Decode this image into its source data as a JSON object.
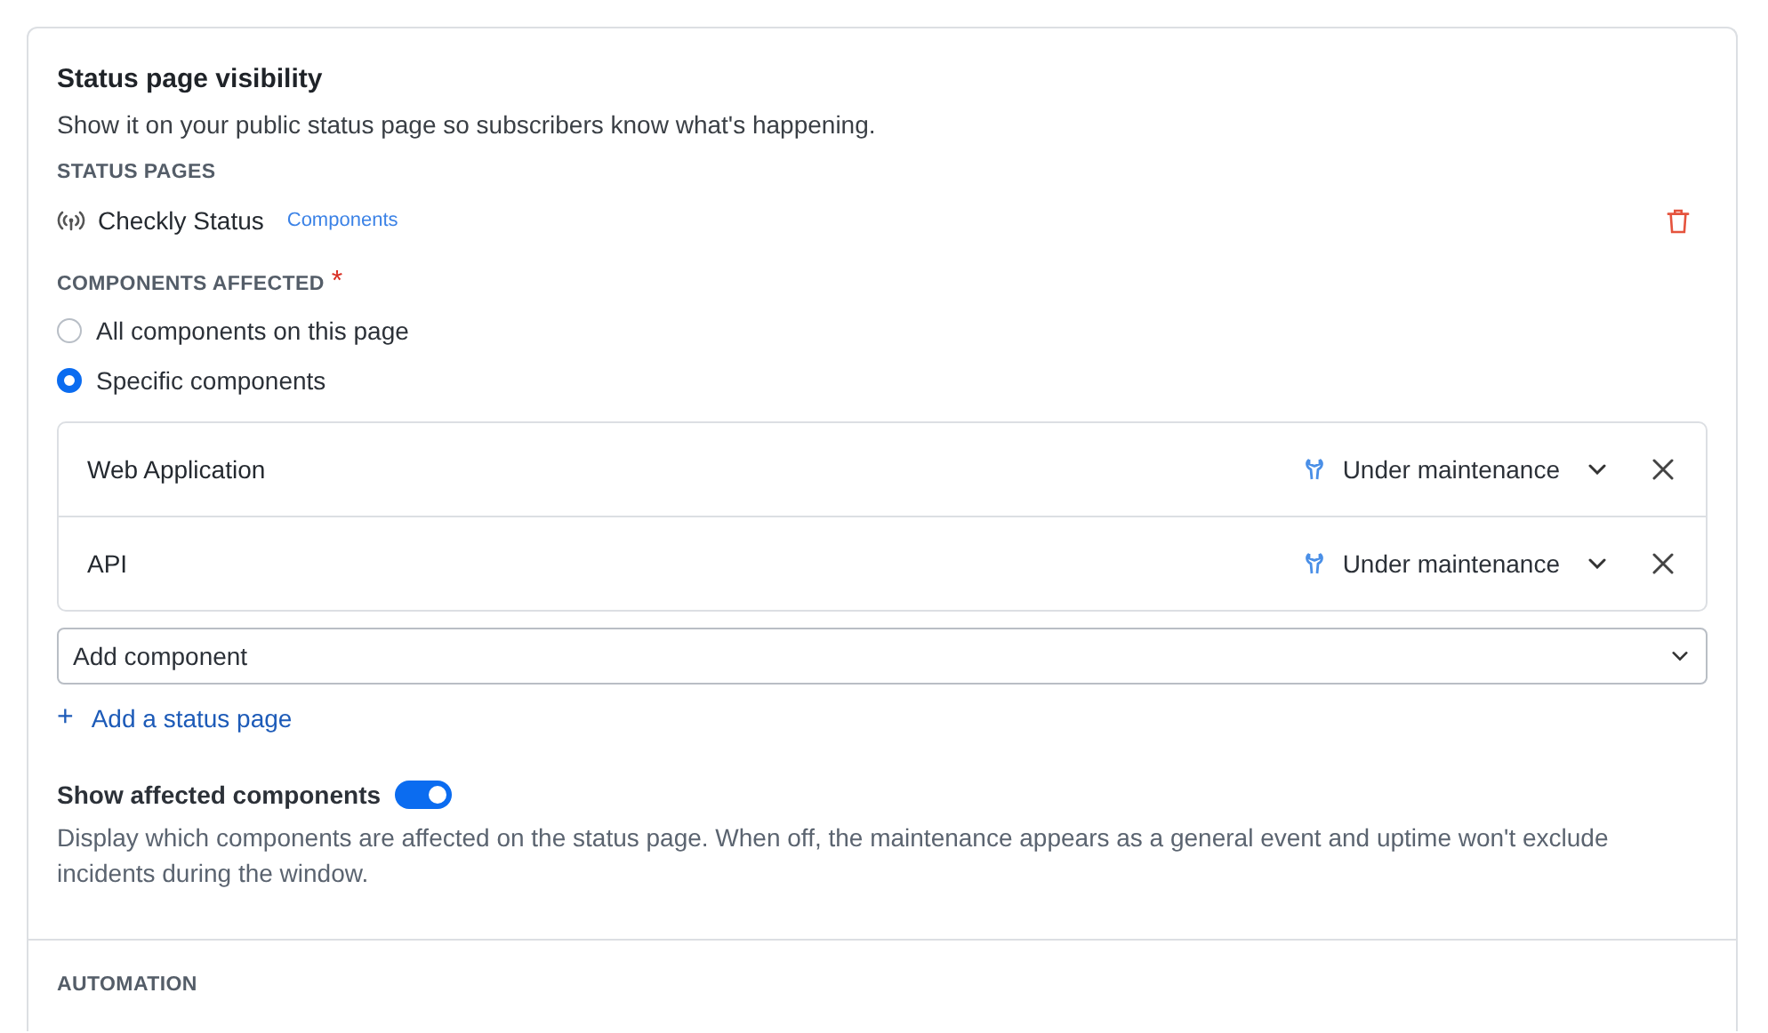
{
  "section": {
    "title": "Status page visibility",
    "description": "Show it on your public status page so subscribers know what's happening."
  },
  "status_pages": {
    "label": "STATUS PAGES",
    "items": [
      {
        "name": "Checkly Status",
        "tag": "Components"
      }
    ]
  },
  "components_affected": {
    "label": "COMPONENTS AFFECTED",
    "required_mark": "*",
    "options": [
      {
        "label": "All components on this page",
        "selected": false
      },
      {
        "label": "Specific components",
        "selected": true
      }
    ],
    "components": [
      {
        "name": "Web Application",
        "status": "Under maintenance"
      },
      {
        "name": "API",
        "status": "Under maintenance"
      }
    ],
    "add_component": {
      "placeholder": "Add component"
    }
  },
  "add_status_page": {
    "label": "Add a status page",
    "icon": "+"
  },
  "show_affected": {
    "label": "Show affected components",
    "on": true,
    "description": "Display which components are affected on the status page. When off, the maintenance appears as a general event and uptime won't exclude incidents during the window."
  },
  "automation": {
    "label": "AUTOMATION"
  }
}
